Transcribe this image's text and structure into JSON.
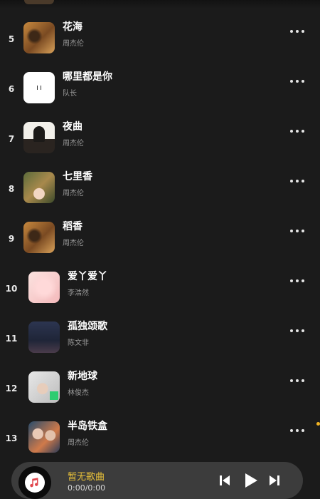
{
  "songs": [
    {
      "index": "5",
      "title": "花海",
      "artist": "周杰伦",
      "cover": "flower-cover"
    },
    {
      "index": "6",
      "title": "哪里都是你",
      "artist": "队长",
      "cover": "white-cover"
    },
    {
      "index": "7",
      "title": "夜曲",
      "artist": "周杰伦",
      "cover": "night-cover"
    },
    {
      "index": "8",
      "title": "七里香",
      "artist": "周杰伦",
      "cover": "qili-cover"
    },
    {
      "index": "9",
      "title": "稻香",
      "artist": "周杰伦",
      "cover": "flower-cover"
    },
    {
      "index": "10",
      "title": "爱丫爱丫",
      "artist": "李浩然",
      "cover": "pink-cover"
    },
    {
      "index": "11",
      "title": "孤独颂歌",
      "artist": "陈文非",
      "cover": "lonely-cover"
    },
    {
      "index": "12",
      "title": "新地球",
      "artist": "林俊杰",
      "cover": "earth-cover"
    },
    {
      "index": "13",
      "title": "半岛铁盒",
      "artist": "周杰伦",
      "cover": "box-cover"
    }
  ],
  "player": {
    "title": "暂无歌曲",
    "time": "0:00/0:00",
    "icon": "music-note-icon",
    "accent": "#e8c13a"
  },
  "icons": {
    "more": "more-dots-icon",
    "prev": "skip-previous-icon",
    "play": "play-icon",
    "next": "skip-next-icon"
  }
}
